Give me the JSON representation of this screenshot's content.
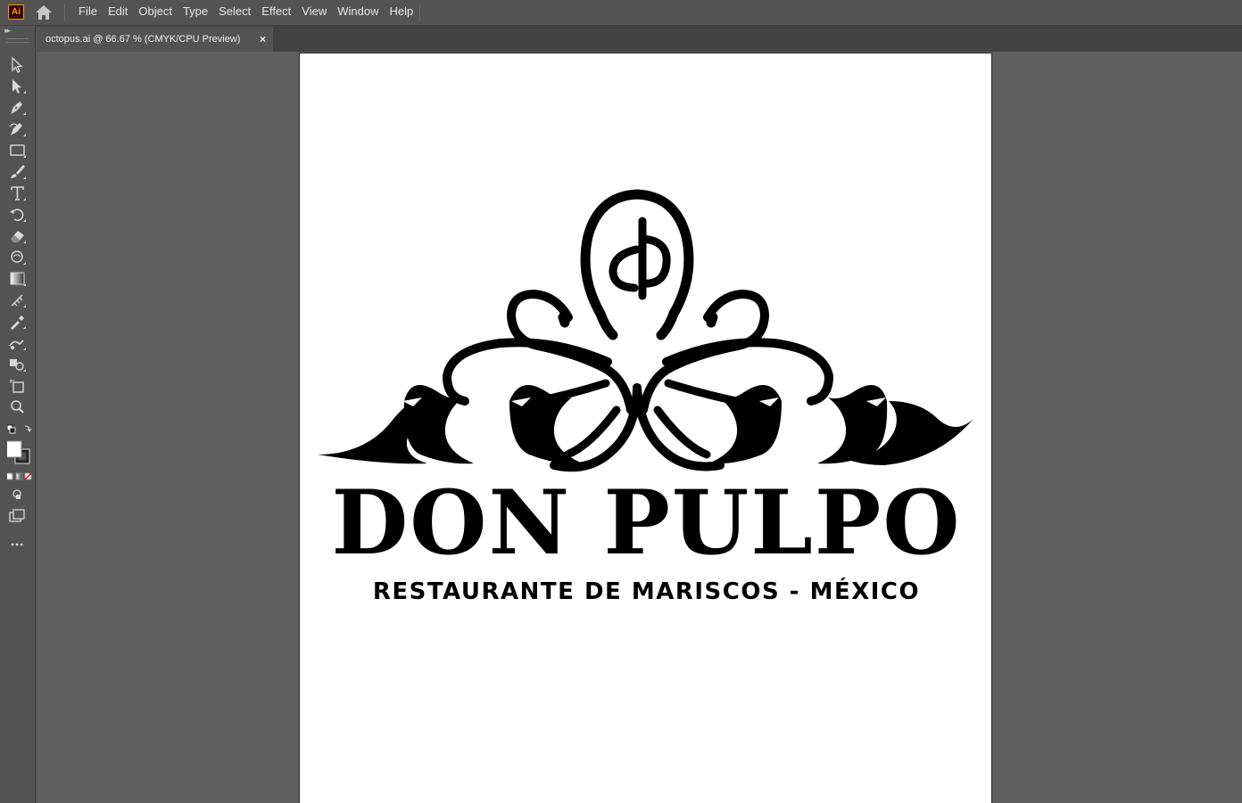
{
  "app": {
    "logo_text": "Ai",
    "name": "Adobe Illustrator"
  },
  "menu": {
    "items": [
      "File",
      "Edit",
      "Object",
      "Type",
      "Select",
      "Effect",
      "View",
      "Window",
      "Help"
    ]
  },
  "document_tab": {
    "title": "octopus.ai @ 66.67 % (CMYK/CPU Preview)",
    "close_label": "×"
  },
  "artboard": {
    "brand_name": "DON PULPO",
    "subtitle": "RESTAURANTE DE MARISCOS - MÉXICO"
  },
  "toolbar": {
    "tools": [
      "selection-tool-icon",
      "direct-selection-tool-icon",
      "pen-tool-icon",
      "curvature-tool-icon",
      "rectangle-tool-icon",
      "paintbrush-tool-icon",
      "type-tool-icon",
      "rotate-tool-icon",
      "eraser-tool-icon",
      "warp-tool-icon",
      "gradient-tool-icon",
      "mesh-tool-icon",
      "eyedropper-tool-icon",
      "blend-tool-icon",
      "shape-builder-tool-icon",
      "artboard-tool-icon",
      "zoom-tool-icon"
    ]
  },
  "colors": {
    "ui_background": "#535353",
    "canvas_background": "#5f5f5f",
    "artboard": "#ffffff",
    "ai_logo_accent": "#ff9a00"
  }
}
